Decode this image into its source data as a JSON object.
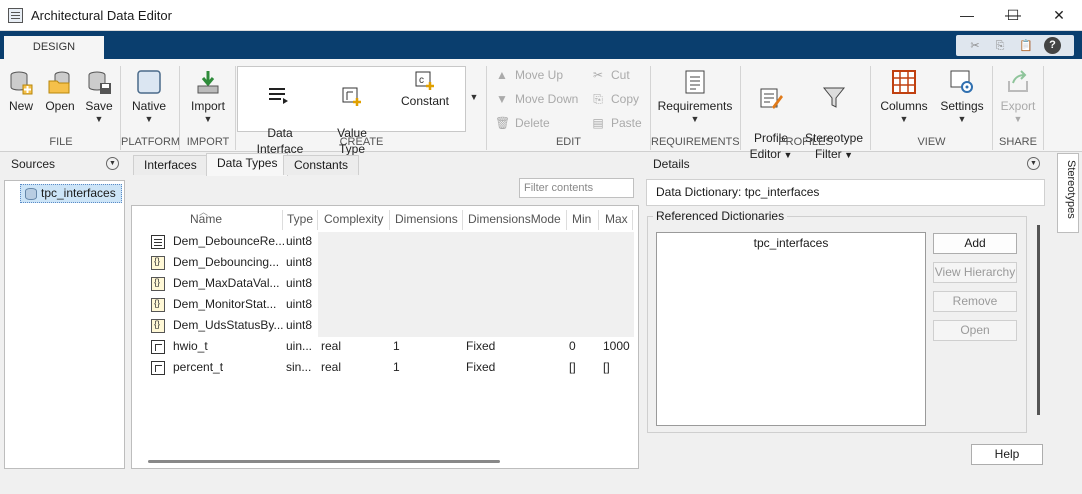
{
  "window": {
    "title": "Architectural Data Editor",
    "minimize": "—",
    "maximize": "☐",
    "close": "✕"
  },
  "ribbon": {
    "active_tab": "DESIGN",
    "quick_access": [
      "✂",
      "⎘",
      "📋",
      "?"
    ],
    "file": {
      "label": "FILE",
      "new": "New",
      "open": "Open",
      "save": "Save"
    },
    "platform": {
      "label": "PLATFORM",
      "native": "Native"
    },
    "import": {
      "label": "IMPORT",
      "import": "Import"
    },
    "create": {
      "label": "CREATE",
      "data_interface": "Data\nInterface",
      "value_type": "Value\nType",
      "constant": "Constant"
    },
    "edit": {
      "label": "EDIT",
      "move_up": "Move Up",
      "move_down": "Move Down",
      "delete": "Delete",
      "cut": "Cut",
      "copy": "Copy",
      "paste": "Paste"
    },
    "requirements": {
      "label": "REQUIREMENTS",
      "requirements": "Requirements"
    },
    "profiles": {
      "label": "PROFILES",
      "profile_editor": "Profile\nEditor",
      "stereotype_filter": "Stereotype\nFilter"
    },
    "view": {
      "label": "VIEW",
      "columns": "Columns",
      "settings": "Settings"
    },
    "share": {
      "label": "SHARE",
      "export": "Export"
    }
  },
  "sources": {
    "title": "Sources",
    "items": [
      {
        "label": "tpc_interfaces"
      }
    ]
  },
  "tabs": [
    {
      "label": "Interfaces"
    },
    {
      "label": "Data Types"
    },
    {
      "label": "Constants"
    }
  ],
  "filter": {
    "placeholder": "Filter contents"
  },
  "table": {
    "columns": [
      "Name",
      "Type",
      "Complexity",
      "Dimensions",
      "DimensionsMode",
      "Min",
      "Max"
    ],
    "rows": [
      {
        "icon": "bus-icon",
        "name": "Dem_DebounceRe...",
        "type": "uint8",
        "complexity": "",
        "dimensions": "",
        "mode": "",
        "min": "",
        "max": ""
      },
      {
        "icon": "enum-icon",
        "name": "Dem_Debouncing...",
        "type": "uint8",
        "complexity": "",
        "dimensions": "",
        "mode": "",
        "min": "",
        "max": ""
      },
      {
        "icon": "enum-icon",
        "name": "Dem_MaxDataVal...",
        "type": "uint8",
        "complexity": "",
        "dimensions": "",
        "mode": "",
        "min": "",
        "max": ""
      },
      {
        "icon": "enum-icon",
        "name": "Dem_MonitorStat...",
        "type": "uint8",
        "complexity": "",
        "dimensions": "",
        "mode": "",
        "min": "",
        "max": ""
      },
      {
        "icon": "enum-icon",
        "name": "Dem_UdsStatusBy...",
        "type": "uint8",
        "complexity": "",
        "dimensions": "",
        "mode": "",
        "min": "",
        "max": ""
      },
      {
        "icon": "alias-icon",
        "name": "hwio_t",
        "type": "uin...",
        "complexity": "real",
        "dimensions": "1",
        "mode": "Fixed",
        "min": "0",
        "max": "1000"
      },
      {
        "icon": "alias-icon",
        "name": "percent_t",
        "type": "sin...",
        "complexity": "real",
        "dimensions": "1",
        "mode": "Fixed",
        "min": "[]",
        "max": "[]"
      }
    ]
  },
  "details": {
    "title": "Details",
    "dictionary": "Data Dictionary: tpc_interfaces",
    "referenced_label": "Referenced Dictionaries",
    "referenced_items": [
      "tpc_interfaces"
    ],
    "buttons": {
      "add": "Add",
      "view_hierarchy": "View Hierarchy",
      "remove": "Remove",
      "open": "Open"
    },
    "help": "Help"
  },
  "side_tab": {
    "label": "Stereotypes"
  }
}
